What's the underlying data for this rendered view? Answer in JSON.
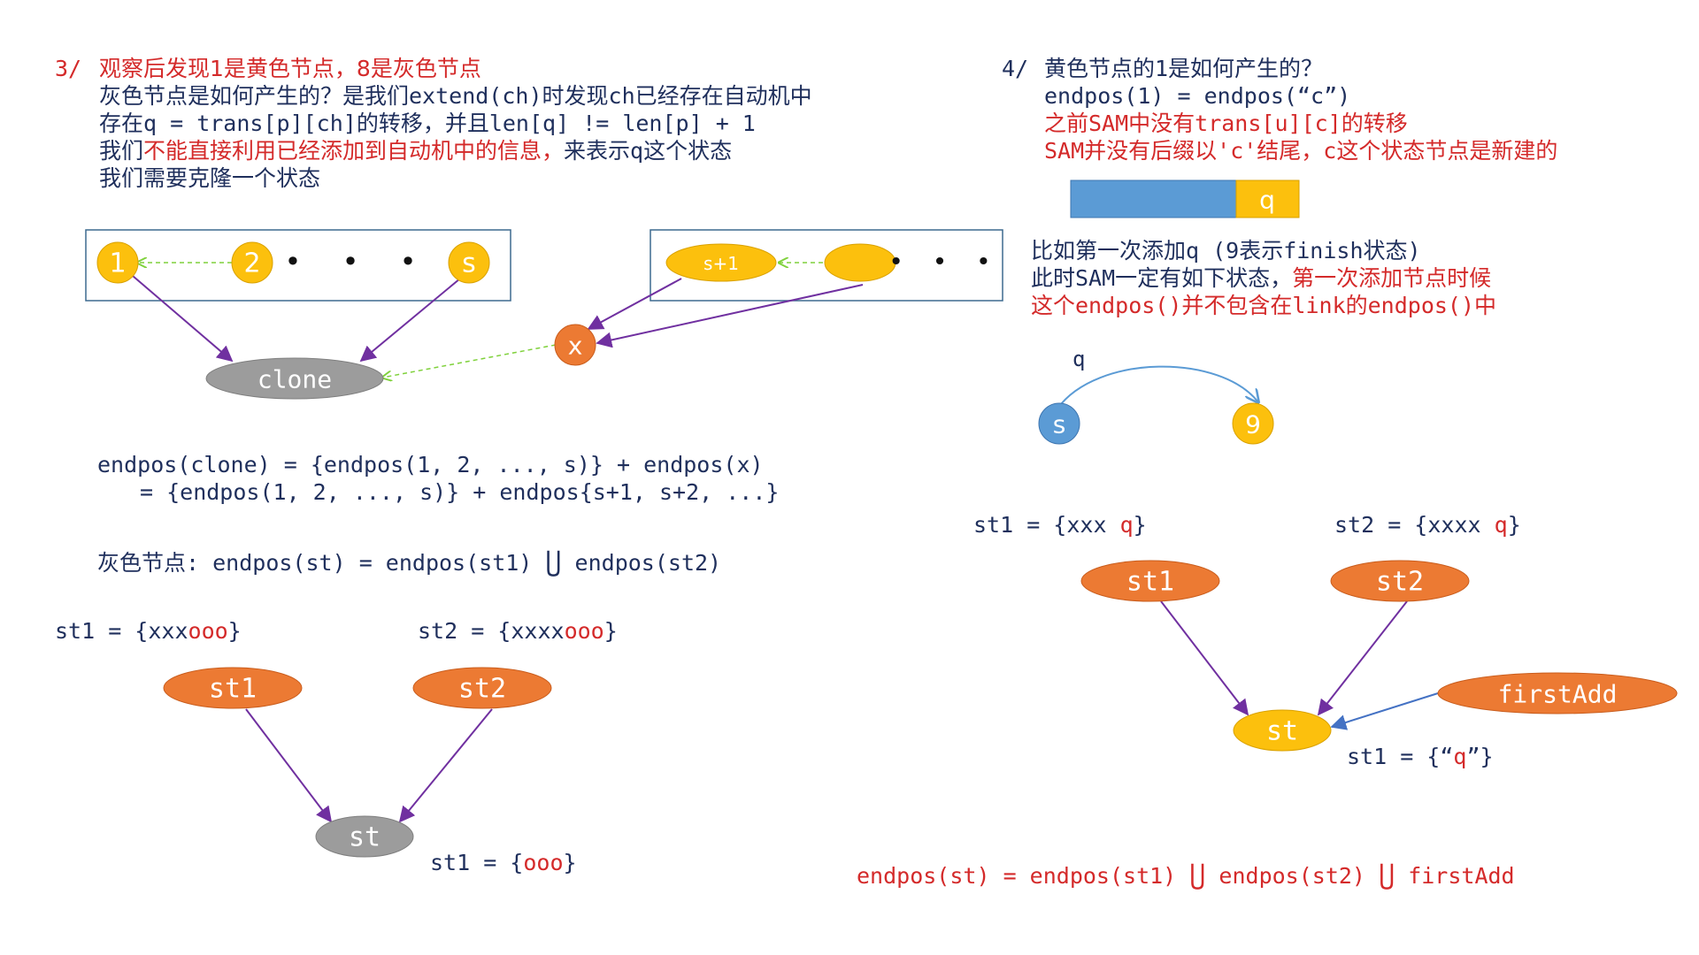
{
  "left": {
    "heading_num": "3/",
    "heading": "观察后发现1是黄色节点，8是灰色节点",
    "line2": "灰色节点是如何产生的？是我们extend(ch)时发现ch已经存在自动机中",
    "line3": "存在q = trans[p][ch]的转移，并且len[q] != len[p] + 1",
    "line4_a": "我们",
    "line4_b": "不能直接利用已经添加到自动机中的信息，",
    "line4_c": "来表示q这个状态",
    "line5": "我们需要克隆一个状态",
    "nodes": {
      "n1": "1",
      "n2": "2",
      "ns": "s",
      "dots": "• • •",
      "s1": "s+1",
      "dots2": "• • •",
      "x": "x",
      "clone": "clone"
    },
    "eq1": "endpos(clone) = {endpos(1, 2, ..., s)} + endpos(x)",
    "eq2": "= {endpos(1, 2, ..., s)} + endpos{s+1, s+2, ...}",
    "gray_label": "灰色节点:",
    "gray_eq_a": "endpos(st) = endpos(st1)",
    "union": "⋃",
    "gray_eq_b": "endpos(st2)",
    "st1_set_a": "st1 = {xxx",
    "st1_set_b": "ooo",
    "st1_set_c": "}",
    "st2_set_a": "st2 = {xxxx",
    "st2_set_b": "ooo",
    "st2_set_c": "}",
    "st1_node": "st1",
    "st2_node": "st2",
    "st_node": "st",
    "st_set_a": "st1 = {",
    "st_set_b": "ooo",
    "st_set_c": "}"
  },
  "right": {
    "heading_num": "4/",
    "heading": "黄色节点的1是如何产生的？",
    "line2": "endpos(1) = endpos(“c”)",
    "line3": "之前SAM中没有trans[u][c]的转移",
    "line4": "SAM并没有后缀以'c'结尾，c这个状态节点是新建的",
    "bar_label": "q",
    "line5": "比如第一次添加q (9表示finish状态)",
    "line6_a": "此时SAM一定有如下状态，",
    "line6_b": "第一次添加节点时候",
    "line7": "这个endpos()并不包含在link的endpos()中",
    "edge_label": "q",
    "node_s": "s",
    "node_9": "9",
    "st1_set_a": "st1 = {xxx ",
    "st1_set_b": "q",
    "st1_set_c": "}",
    "st2_set_a": "st2 = {xxxx ",
    "st2_set_b": "q",
    "st2_set_c": "}",
    "st1_node": "st1",
    "st2_node": "st2",
    "first_node": "firstAdd",
    "st_node": "st",
    "st_set_a": "st1 = {“",
    "st_set_b": "q",
    "st_set_c": "”}",
    "final_a": "endpos(st) = endpos(st1)",
    "final_union1": "⋃",
    "final_b": "endpos(st2)",
    "final_union2": "⋃",
    "final_c": "firstAdd"
  },
  "colors": {
    "red": "#d42a2a",
    "navy": "#1f2f5c",
    "yellow": "#fcc00d",
    "orange": "#ec7a33",
    "gray": "#9c9c9c",
    "blue": "#5b9bd5",
    "purple": "#7030a0",
    "green_dashed": "#7fd13b",
    "box_border": "#3d6a8f"
  }
}
